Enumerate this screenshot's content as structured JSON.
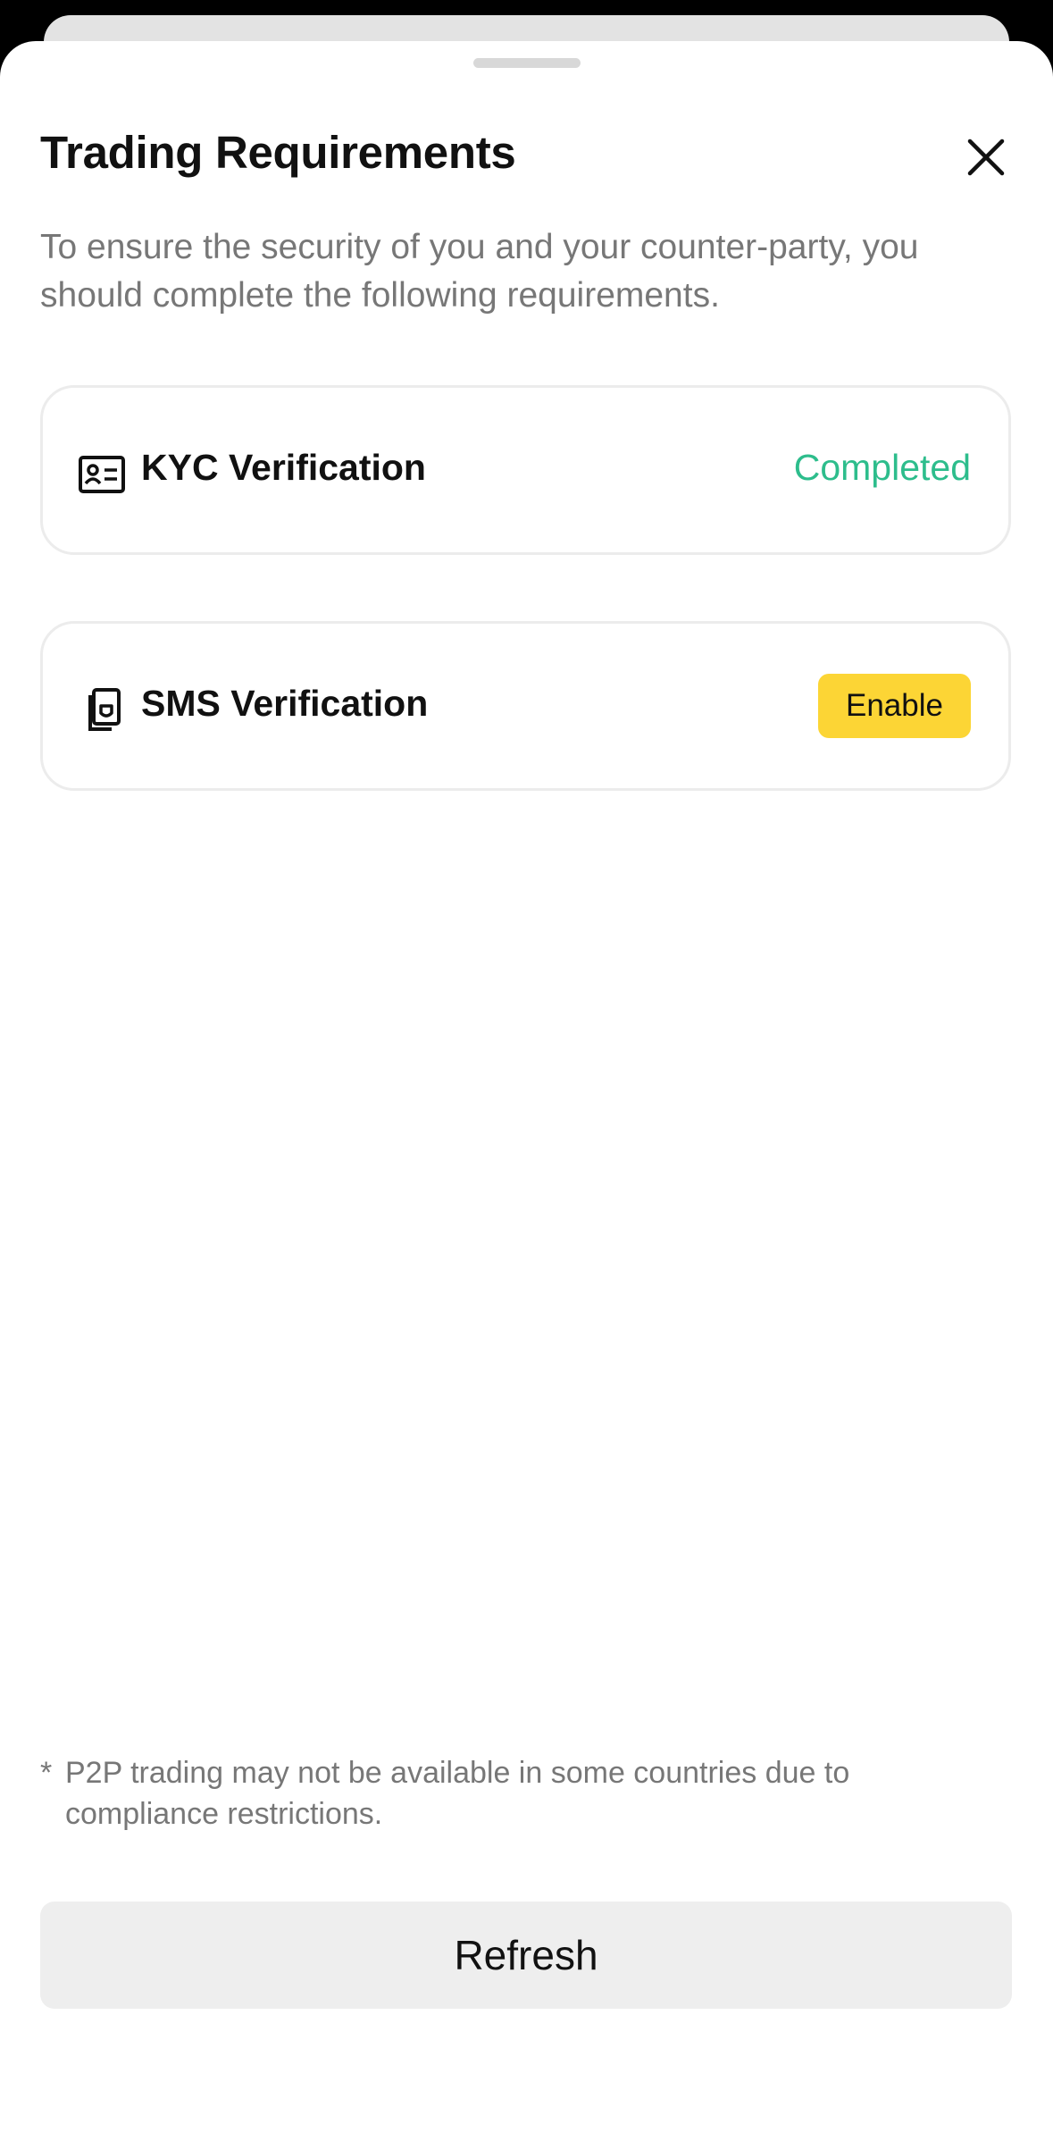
{
  "sheet": {
    "title": "Trading Requirements",
    "close_icon": "close-icon",
    "subtitle": "To ensure the security of you and your counter-party, you should complete the following requirements."
  },
  "requirements": [
    {
      "label": "KYC Verification",
      "icon": "id-card-icon",
      "status": "Completed",
      "status_color": "#2dbd8c"
    },
    {
      "label": "SMS Verification",
      "icon": "phone-shield-icon",
      "action": "Enable",
      "action_color": "#fcd535"
    }
  ],
  "footnote": {
    "marker": "*",
    "text": "P2P trading may not be available in some countries due to compliance restrictions."
  },
  "refresh_button": "Refresh"
}
